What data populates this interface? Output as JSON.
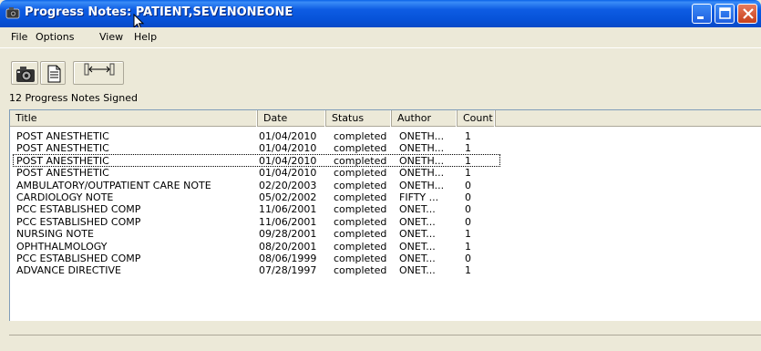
{
  "window": {
    "title": "Progress Notes: PATIENT,SEVENONEONE"
  },
  "menu": [
    "File",
    "Options",
    "View",
    "Help"
  ],
  "toolbar": {
    "buttons": [
      {
        "icon": "camera-icon"
      },
      {
        "icon": "document-icon"
      },
      {
        "icon": "column-width-icon"
      }
    ],
    "status_label": "12  Progress Notes Signed"
  },
  "list": {
    "columns": [
      "Title",
      "Date",
      "Status",
      "Author",
      "Count"
    ],
    "rows": [
      {
        "title": "POST ANESTHETIC",
        "date": "01/04/2010",
        "status": "completed",
        "author": "ONETH...",
        "count": "1"
      },
      {
        "title": "POST ANESTHETIC",
        "date": "01/04/2010",
        "status": "completed",
        "author": "ONETH...",
        "count": "1"
      },
      {
        "title": "POST ANESTHETIC",
        "date": "01/04/2010",
        "status": "completed",
        "author": "ONETH...",
        "count": "1"
      },
      {
        "title": "POST ANESTHETIC",
        "date": "01/04/2010",
        "status": "completed",
        "author": "ONETH...",
        "count": "1"
      },
      {
        "title": "AMBULATORY/OUTPATIENT CARE NOTE",
        "date": "02/20/2003",
        "status": "completed",
        "author": "ONETH...",
        "count": "0"
      },
      {
        "title": "CARDIOLOGY NOTE",
        "date": "05/02/2002",
        "status": "completed",
        "author": "FIFTY ...",
        "count": "0"
      },
      {
        "title": "PCC ESTABLISHED COMP",
        "date": "11/06/2001",
        "status": "completed",
        "author": "ONET...",
        "count": "0"
      },
      {
        "title": "PCC ESTABLISHED COMP",
        "date": "11/06/2001",
        "status": "completed",
        "author": "ONET...",
        "count": "0"
      },
      {
        "title": "NURSING NOTE",
        "date": "09/28/2001",
        "status": "completed",
        "author": "ONET...",
        "count": "1"
      },
      {
        "title": "OPHTHALMOLOGY",
        "date": "08/20/2001",
        "status": "completed",
        "author": "ONET...",
        "count": "1"
      },
      {
        "title": "PCC ESTABLISHED COMP",
        "date": "08/06/1999",
        "status": "completed",
        "author": "ONET...",
        "count": "0"
      },
      {
        "title": "ADVANCE DIRECTIVE",
        "date": "07/28/1997",
        "status": "completed",
        "author": "ONET...",
        "count": "1"
      }
    ]
  }
}
